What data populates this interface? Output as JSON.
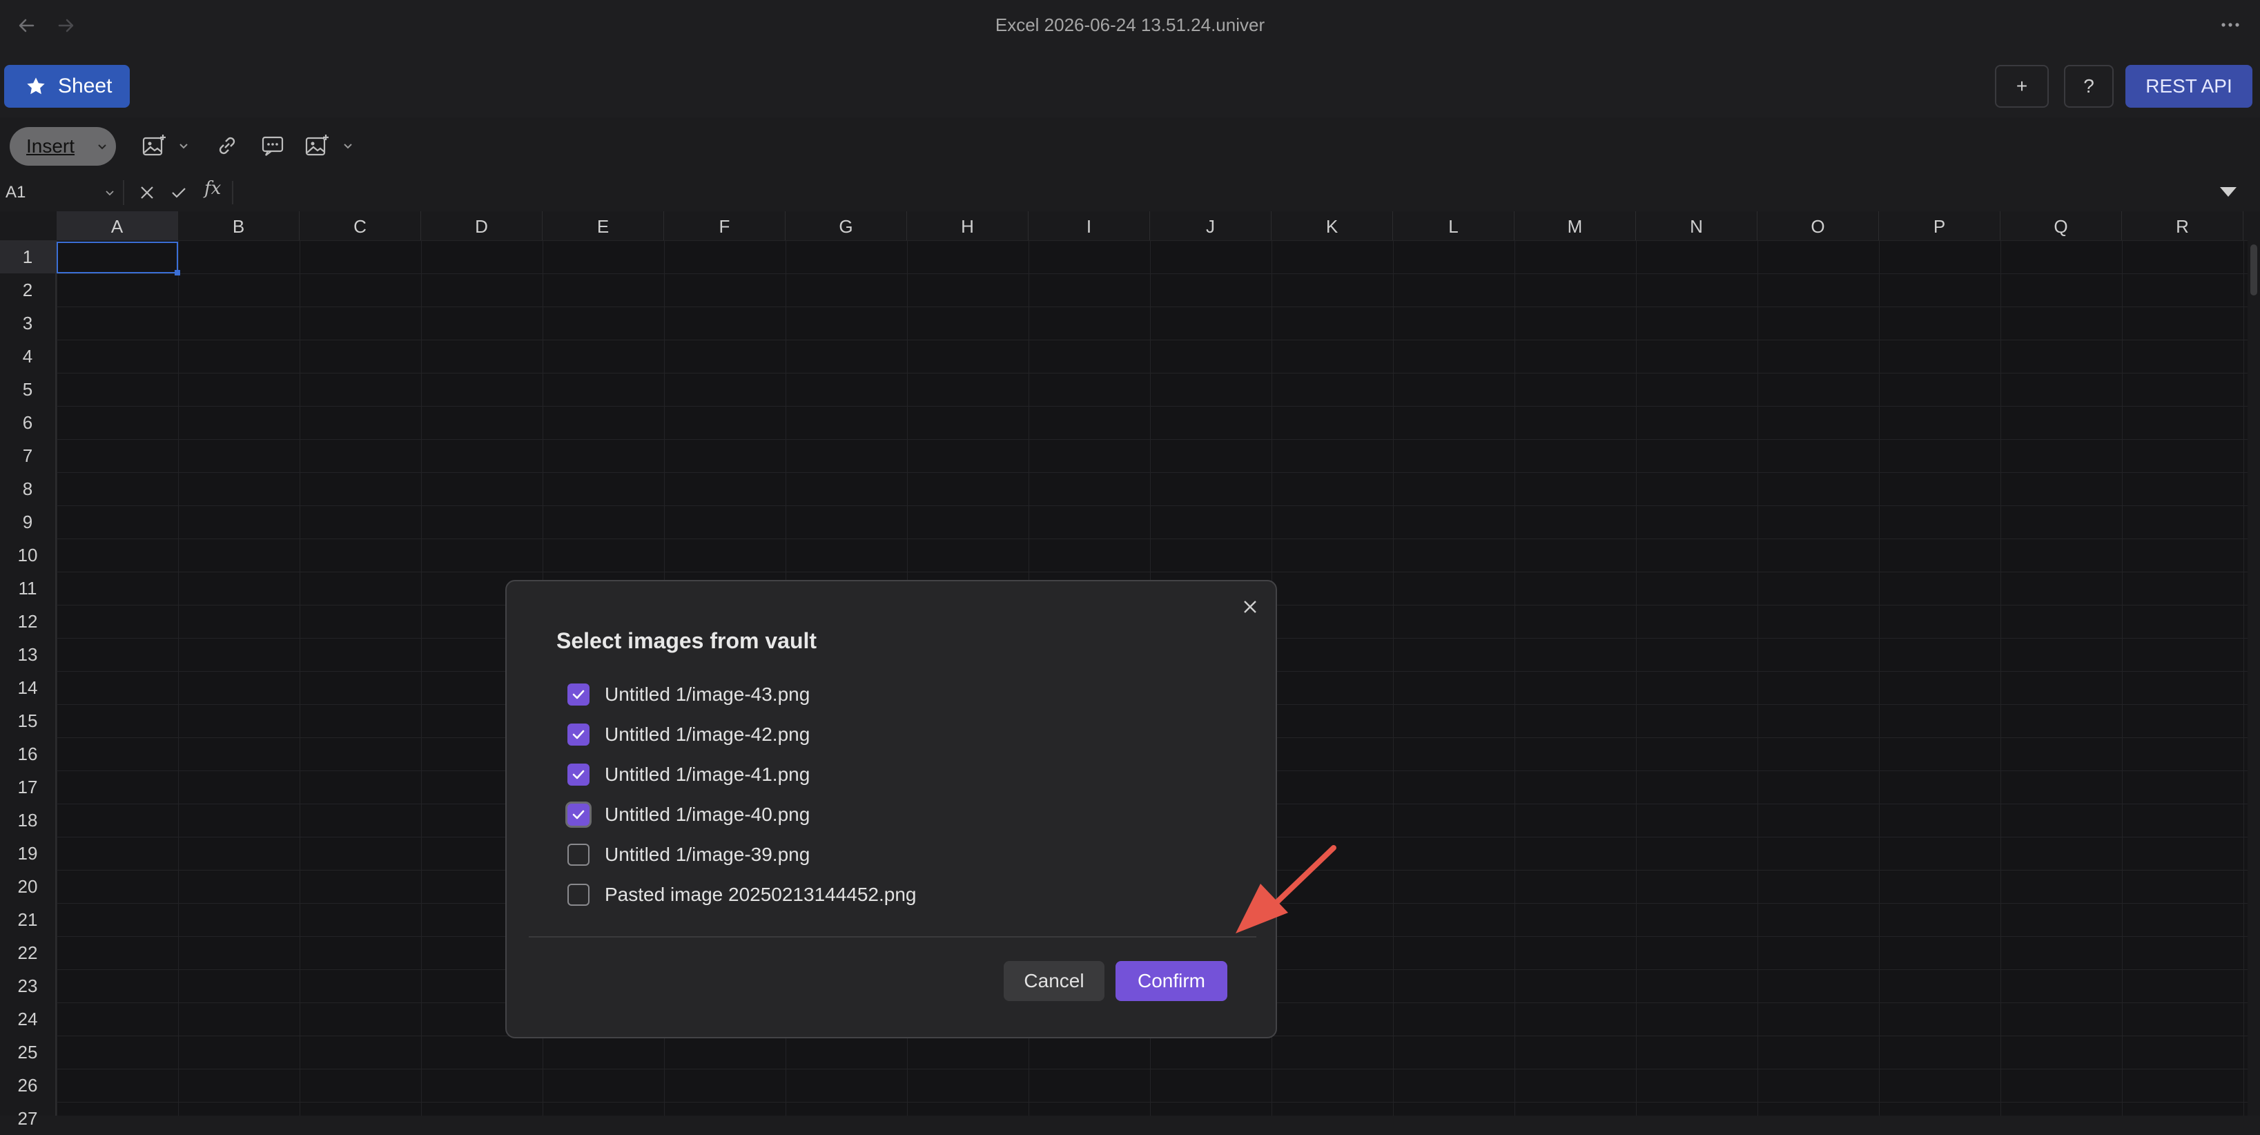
{
  "window": {
    "title": "Excel 2026-06-24 13.51.24.univer"
  },
  "header": {
    "sheet_label": "Sheet",
    "plus_label": "+",
    "help_label": "?",
    "rest_api_label": "REST API"
  },
  "toolbar": {
    "insert_label": "Insert"
  },
  "formula_bar": {
    "cell_ref": "A1",
    "fx_label": "fx"
  },
  "grid": {
    "columns": [
      "A",
      "B",
      "C",
      "D",
      "E",
      "F",
      "G",
      "H",
      "I",
      "J",
      "K",
      "L",
      "M",
      "N",
      "O",
      "P",
      "Q",
      "R"
    ],
    "rows": [
      "1",
      "2",
      "3",
      "4",
      "5",
      "6",
      "7",
      "8",
      "9",
      "10",
      "11",
      "12",
      "13",
      "14",
      "15",
      "16",
      "17",
      "18",
      "19",
      "20",
      "21",
      "22",
      "23",
      "24",
      "25",
      "26",
      "27"
    ],
    "selected_cell": "A1"
  },
  "dialog": {
    "title": "Select images from vault",
    "items": [
      {
        "label": "Untitled 1/image-43.png",
        "checked": true
      },
      {
        "label": "Untitled 1/image-42.png",
        "checked": true
      },
      {
        "label": "Untitled 1/image-41.png",
        "checked": true
      },
      {
        "label": "Untitled 1/image-40.png",
        "checked": true
      },
      {
        "label": "Untitled 1/image-39.png",
        "checked": false
      },
      {
        "label": "Pasted image 20250213144452.png",
        "checked": false
      }
    ],
    "cancel_label": "Cancel",
    "confirm_label": "Confirm"
  },
  "colors": {
    "accent": "#7452d8",
    "sheet_button": "#2f58b6",
    "rest_button": "#3a4da8",
    "annotation_arrow": "#e8574a"
  }
}
